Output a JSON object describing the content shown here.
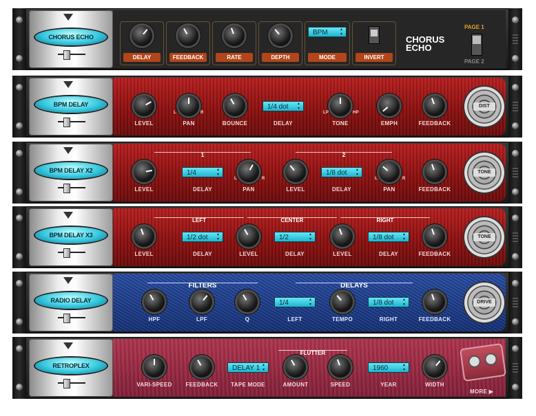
{
  "racks": [
    {
      "name": "CHORUS ECHO"
    },
    {
      "name": "BPM DELAY"
    },
    {
      "name": "BPM DELAY X2"
    },
    {
      "name": "BPM DELAY X3"
    },
    {
      "name": "RADIO DELAY"
    },
    {
      "name": "RETROPLEX"
    }
  ],
  "chorus_echo": {
    "labels": [
      "DELAY",
      "FEEDBACK",
      "RATE",
      "DEPTH",
      "MODE",
      "INVERT"
    ],
    "mode_value": "BPM",
    "title_line1": "CHORUS",
    "title_line2": "ECHO",
    "page1": "PAGE 1",
    "page2": "PAGE 2"
  },
  "bpm_delay": {
    "labels": [
      "LEVEL",
      "PAN",
      "BOUNCE",
      "DELAY",
      "TONE",
      "EMPH",
      "FEEDBACK"
    ],
    "delay_value": "1/4 dot",
    "pan_l": "L",
    "pan_r": "R",
    "tone_l": "LP",
    "tone_r": "HP",
    "button": "DIST"
  },
  "bpm_delay_x2": {
    "groups": [
      "1",
      "2"
    ],
    "labels": [
      "LEVEL",
      "DELAY",
      "PAN",
      "LEVEL",
      "DELAY",
      "PAN",
      "FEEDBACK"
    ],
    "delay1": "1/4",
    "delay2": "1/8 dot",
    "l": "L",
    "r": "R",
    "button": "TONE"
  },
  "bpm_delay_x3": {
    "groups": [
      "LEFT",
      "CENTER",
      "RIGHT"
    ],
    "labels": [
      "LEVEL",
      "DELAY",
      "LEVEL",
      "DELAY",
      "LEVEL",
      "DELAY",
      "FEEDBACK"
    ],
    "delay1": "1/2 dot",
    "delay2": "1/2",
    "delay3": "1/8 dot",
    "button": "TONE"
  },
  "radio_delay": {
    "groups": [
      "FILTERS",
      "DELAYS"
    ],
    "labels": [
      "HPF",
      "LPF",
      "Q",
      "LEFT",
      "TEMPO",
      "RIGHT",
      "FEEDBACK"
    ],
    "left": "1/4",
    "right": "1/8 dot",
    "button": "DRIVE"
  },
  "retroplex": {
    "group": "FLUTTER",
    "labels": [
      "VARI-SPEED",
      "FEEDBACK",
      "TAPE MODE",
      "AMOUNT",
      "SPEED",
      "YEAR",
      "WIDTH"
    ],
    "tape_mode": "DELAY 1",
    "year": "1960",
    "more": "MORE ▶"
  },
  "colors": {
    "accent": "#35c8df",
    "red_panel": "#a51717",
    "blue_panel": "#1f3f94",
    "pink_panel": "#9e2c45",
    "orange_label": "#b2461a"
  }
}
